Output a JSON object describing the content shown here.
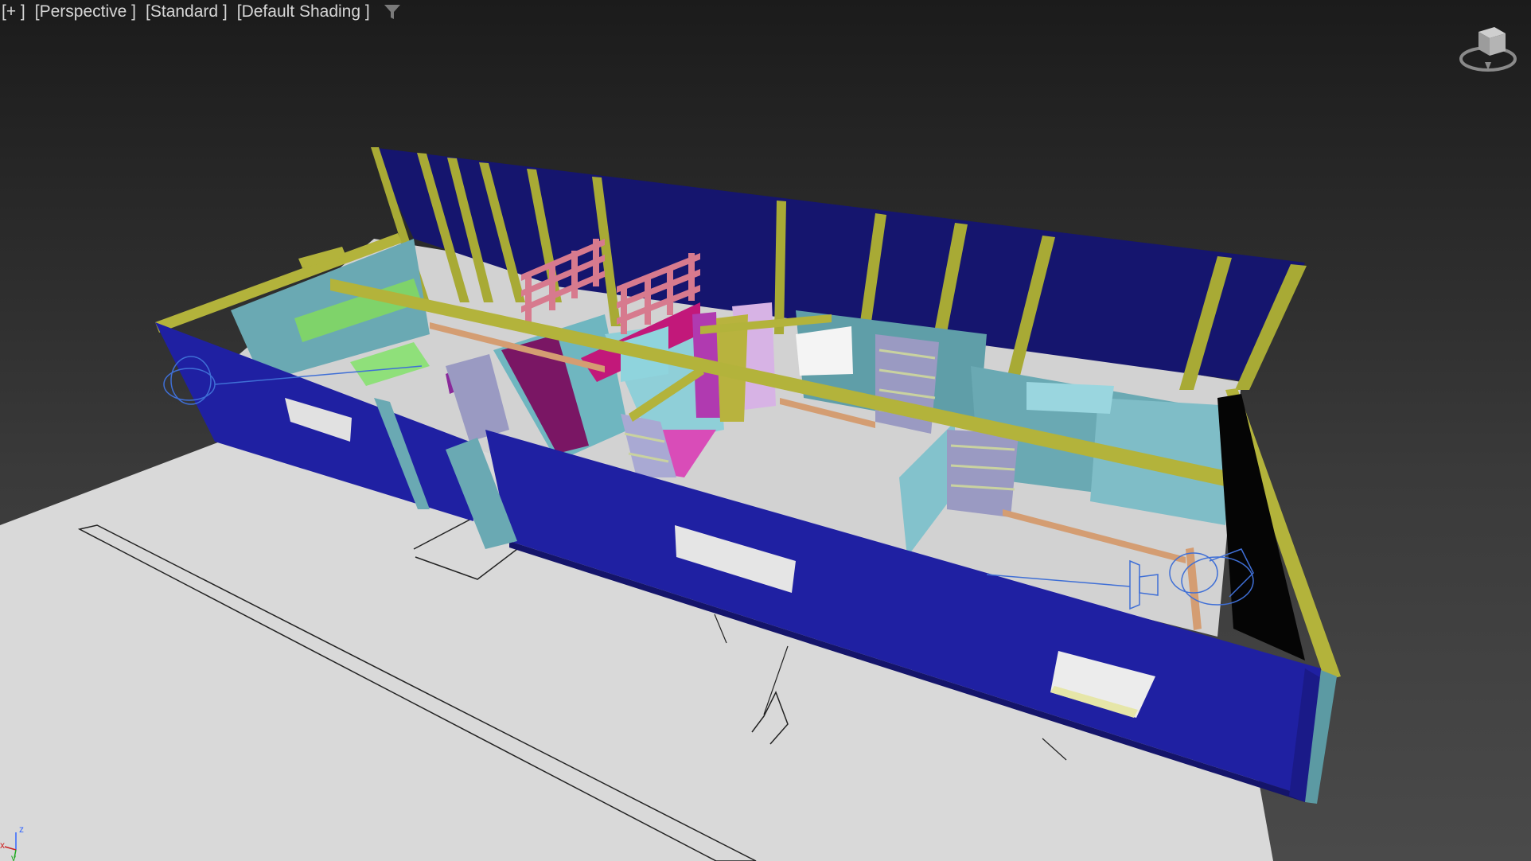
{
  "viewport": {
    "labels": {
      "plus": "[+ ]",
      "view": "[Perspective ]",
      "mode": "[Standard ]",
      "shading": "[Default Shading ]"
    },
    "icons": {
      "filter": "filter-icon",
      "viewcube": "viewcube-icon",
      "axis": "axis-tripod-icon"
    },
    "axis": {
      "x": "x",
      "y": "y",
      "z": "z"
    }
  },
  "colors": {
    "background": "#2b2b2b",
    "ground": "#d8d8d8",
    "wall_blue": "#1f1f9e",
    "wall_blue_dark": "#141466",
    "beam_yellow": "#b6b83a",
    "partition_cyan": "#6fb6c0",
    "magenta": "#8b1a6b",
    "pink": "#d77a8e",
    "axis_x": "#cc2222",
    "axis_y": "#22aa22",
    "axis_z": "#3366ff"
  }
}
